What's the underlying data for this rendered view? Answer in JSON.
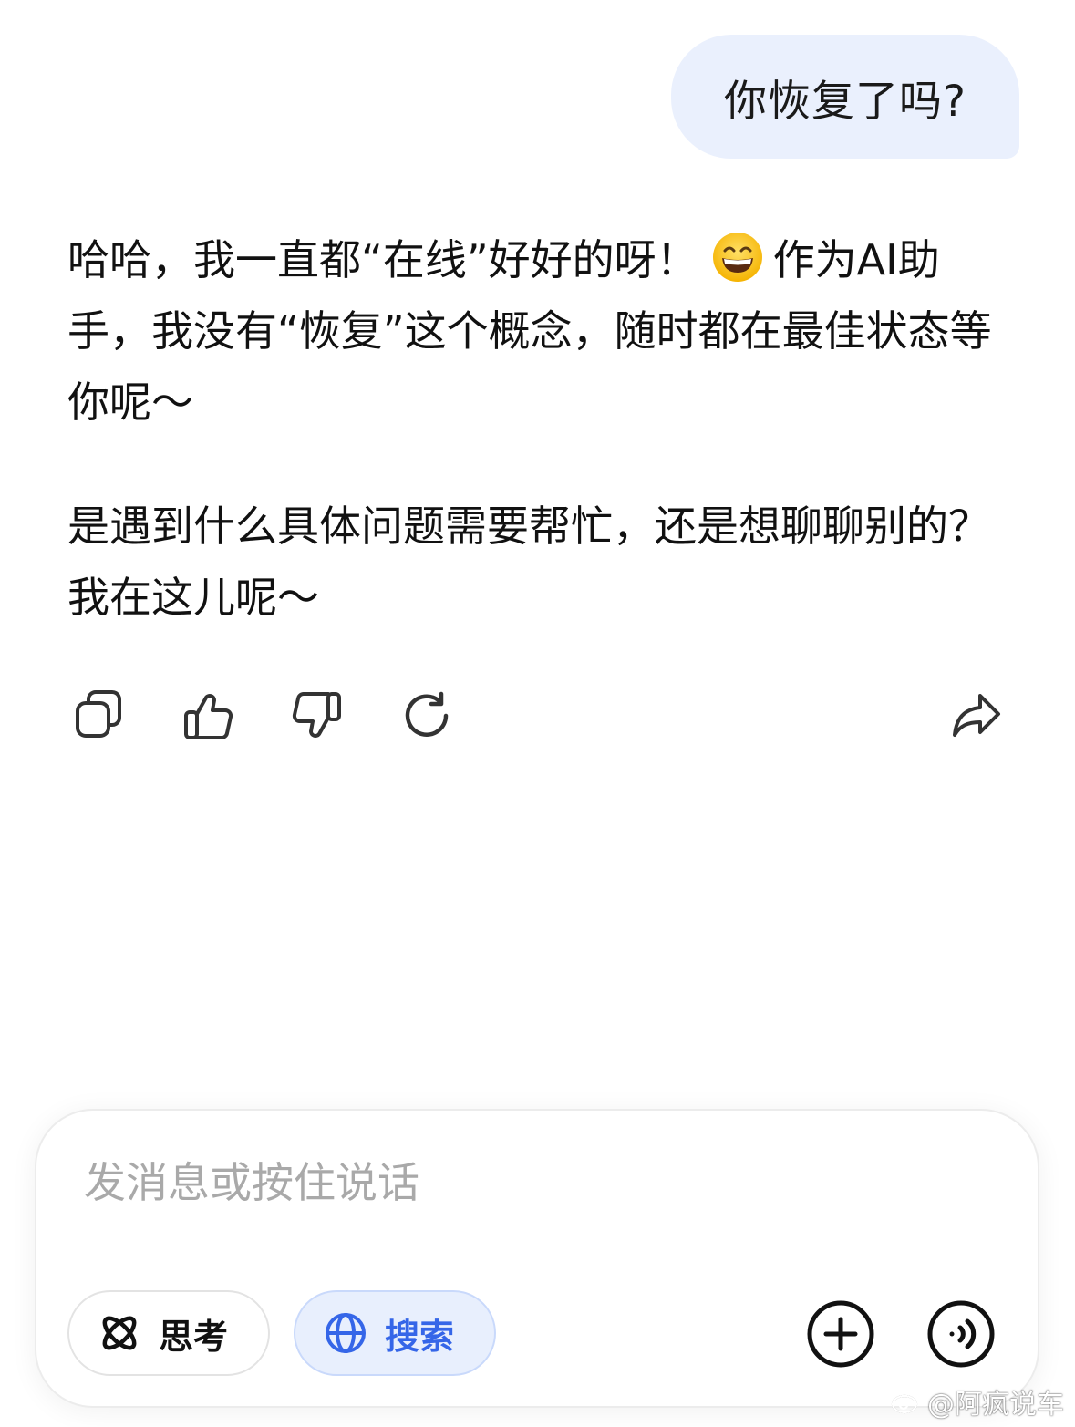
{
  "conversation": {
    "user_message": "你恢复了吗?",
    "reply_line_1_before_emoji": "哈哈，我一直都“在线”好好的呀！",
    "reply_line_1_emoji": "grinning-face-emoji",
    "reply_line_1_after_emoji": "作为AI助手，我没有“恢复”这个概念，随时都在最佳状态等你呢～",
    "reply_paragraph_2": "是遇到什么具体问题需要帮忙，还是想聊聊别的？我在这儿呢～"
  },
  "actions": {
    "icons": [
      "copy-icon",
      "thumbs-up-icon",
      "thumbs-down-icon",
      "regenerate-icon",
      "share-icon"
    ]
  },
  "composer": {
    "placeholder": "发消息或按住说话",
    "think_label": "思考",
    "search_label": "搜索",
    "accent_color": "#3566e8",
    "bubble_color": "#eaf0fd"
  },
  "watermark": {
    "text": "@阿疯说车"
  }
}
